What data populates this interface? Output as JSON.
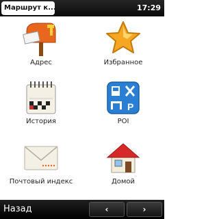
{
  "header": {
    "title": "Маршрут к...",
    "time": "17:29"
  },
  "menu": [
    {
      "label": "Адрес",
      "icon": "mailbox-icon"
    },
    {
      "label": "Избранное",
      "icon": "star-icon"
    },
    {
      "label": "История",
      "icon": "calendar-flag-icon"
    },
    {
      "label": "POI",
      "icon": "poi-icon"
    },
    {
      "label": "Почтовый индекс",
      "icon": "envelope-icon"
    },
    {
      "label": "Домой",
      "icon": "house-icon"
    }
  ],
  "footer": {
    "back": "Назад",
    "prev": "‹",
    "next": "›"
  },
  "colors": {
    "accent": "#e8661e",
    "star": "#f5a623",
    "poi": "#2a7fd4",
    "roof": "#d62828"
  }
}
